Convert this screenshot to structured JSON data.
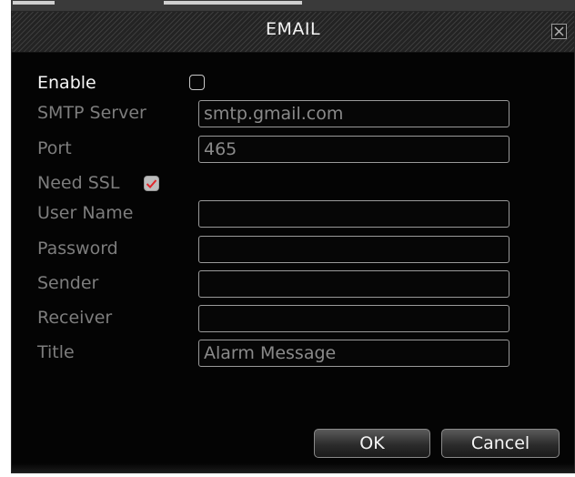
{
  "dialog": {
    "title": "EMAIL"
  },
  "form": {
    "enable": {
      "label": "Enable",
      "checked": false
    },
    "smtp_server": {
      "label": "SMTP Server",
      "value": "smtp.gmail.com"
    },
    "port": {
      "label": "Port",
      "value": "465"
    },
    "need_ssl": {
      "label": "Need SSL",
      "checked": true
    },
    "user_name": {
      "label": "User Name",
      "value": ""
    },
    "password": {
      "label": "Password",
      "value": ""
    },
    "sender": {
      "label": "Sender",
      "value": ""
    },
    "receiver": {
      "label": "Receiver",
      "value": ""
    },
    "title": {
      "label": "Title",
      "value": "Alarm Message"
    }
  },
  "buttons": {
    "ok": "OK",
    "cancel": "Cancel"
  },
  "icons": {
    "close": "close-icon",
    "checkmark": "checkmark-icon"
  },
  "colors": {
    "dialog_bg": "#040404",
    "label_text": "#7d7d7d",
    "active_label_text": "#f6f6f6",
    "field_border": "#9a9a9a",
    "check_mark": "#e0262b"
  }
}
